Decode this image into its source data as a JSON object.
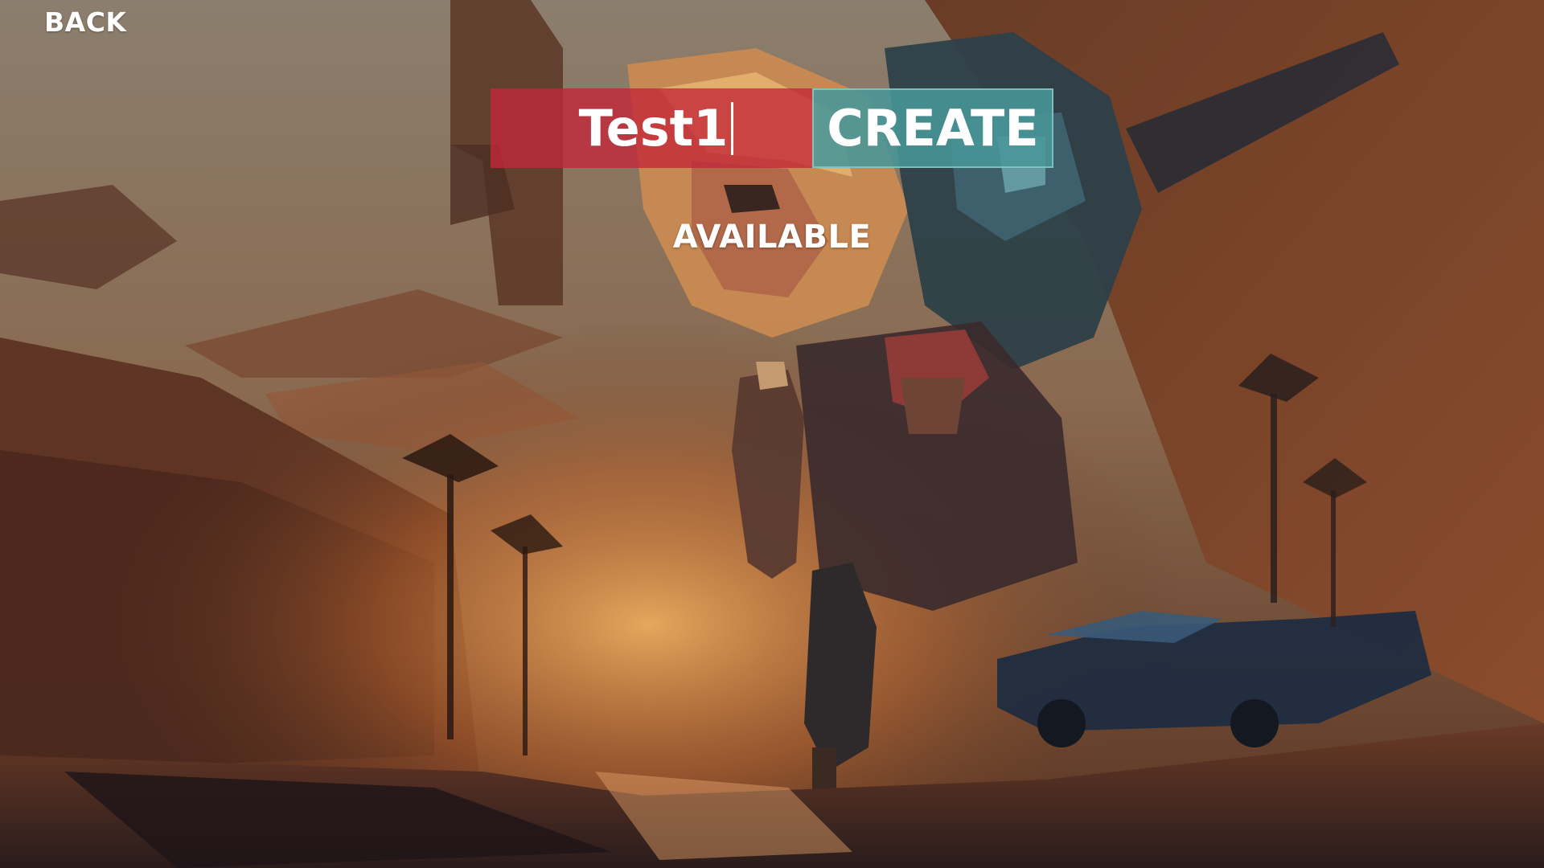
{
  "nav": {
    "back_label": "BACK"
  },
  "name_form": {
    "input_value": "Test1",
    "create_label": "CREATE",
    "availability_status": "AVAILABLE"
  },
  "theme": {
    "field_color": "#c4263a",
    "button_color": "#489698",
    "sky_color": "#8a7a6a",
    "sunset_color": "#e08a3a"
  }
}
